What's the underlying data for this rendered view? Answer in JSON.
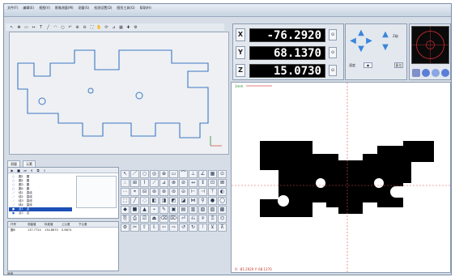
{
  "menu": [
    "文件(F)",
    "编辑(E)",
    "视图(V)",
    "影像测量(M)",
    "测量(S)",
    "检测设置(D)",
    "图形工具(G)",
    "帮助(H)"
  ],
  "cad_toolbar_icons": [
    "pointer-icon",
    "move-icon",
    "rect-select-icon",
    "dimension-icon",
    "text-icon",
    "line-icon",
    "arc-icon",
    "circle-icon",
    "undo-icon",
    "zoom-in-icon",
    "zoom-out-icon",
    "fit-icon",
    "pan-icon",
    "rotate-icon",
    "measure-icon",
    "grid-icon",
    "snap-icon",
    "settings-icon"
  ],
  "tabs": [
    "测量",
    "元素"
  ],
  "feature_list": [
    {
      "icon": "○",
      "name": "圆1",
      "type": "圆"
    },
    {
      "icon": "○",
      "name": "圆2",
      "type": "圆"
    },
    {
      "icon": "○",
      "name": "圆3",
      "type": "圆"
    },
    {
      "icon": "○",
      "name": "圆4",
      "type": "圆"
    },
    {
      "icon": "／",
      "name": "线1",
      "type": "直线"
    },
    {
      "icon": "／",
      "name": "线2",
      "type": "直线"
    },
    {
      "icon": "／",
      "name": "线3",
      "type": "直线"
    },
    {
      "icon": "／",
      "name": "线4",
      "type": "直线"
    },
    {
      "icon": "●",
      "name": "点1",
      "type": "点"
    },
    {
      "icon": "●",
      "name": "点2",
      "type": "点"
    }
  ],
  "selected_feature_index": 8,
  "result_table": {
    "headers": [
      "代号",
      "测量值",
      "标准值",
      "上公差",
      "下公差"
    ],
    "rows": [
      [
        "圆6",
        "137.7724",
        "134.8870",
        "0.6874",
        ""
      ]
    ]
  },
  "status_text": "就绪",
  "dro": {
    "x": {
      "label": "X",
      "value": "-76.2920"
    },
    "y": {
      "label": "Y",
      "value": "68.1370"
    },
    "z": {
      "label": "Z",
      "value": "15.0730"
    }
  },
  "stage": {
    "speed_label": "速度",
    "reset_label": "复位",
    "z_label": "Z轴"
  },
  "video": {
    "scale_label": "1mm",
    "coords_text": "X: -81.2920  Y: 68.1370"
  },
  "colors": {
    "accent": "#3a86d9",
    "dro_bg": "#000000",
    "crosshair": "#d9534f",
    "selection": "#1d4fb5"
  }
}
